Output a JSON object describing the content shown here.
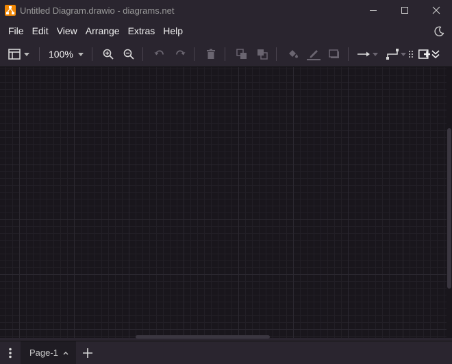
{
  "window": {
    "title": "Untitled Diagram.drawio - diagrams.net",
    "controls": [
      "minimize-icon",
      "maximize-icon",
      "close-icon"
    ]
  },
  "menu": {
    "items": [
      "File",
      "Edit",
      "View",
      "Arrange",
      "Extras",
      "Help"
    ],
    "theme_icon": "moon-icon"
  },
  "toolbar": {
    "zoom_label": "100%",
    "icons": [
      "format-panel-icon",
      "zoom-in-icon",
      "zoom-out-icon",
      "undo-icon",
      "redo-icon",
      "delete-icon",
      "to-front-icon",
      "to-back-icon",
      "fill-color-icon",
      "line-color-icon",
      "shadow-icon",
      "connection-arrow-icon",
      "waypoints-icon",
      "insert-icon",
      "expand-icon"
    ]
  },
  "pages": {
    "tabs": [
      {
        "label": "Page-1"
      }
    ]
  },
  "colors": {
    "accent": "#f08705",
    "background": "#2a252f",
    "canvas": "#19161c"
  }
}
